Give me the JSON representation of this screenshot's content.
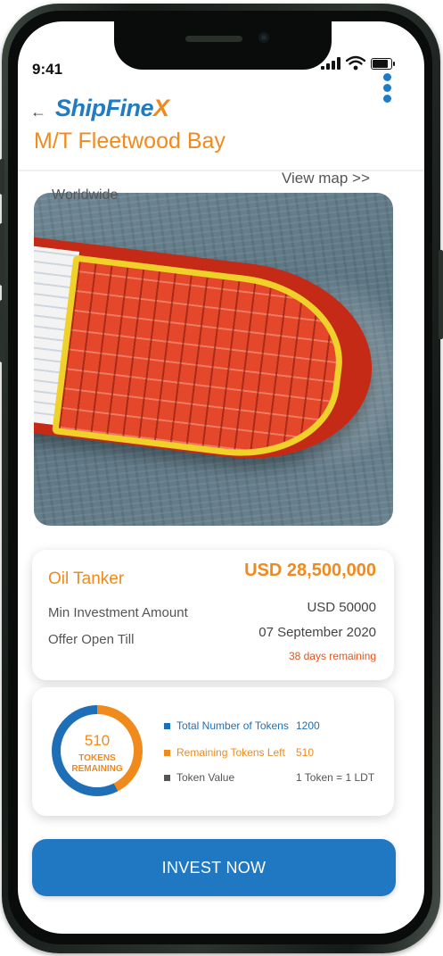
{
  "status_bar": {
    "time": "9:41"
  },
  "header": {
    "logo_main": "ShipFine",
    "logo_accent": "X",
    "title": "M/T Fleetwood Bay"
  },
  "location": {
    "region": "Worldwide",
    "view_map_label": "View map >>"
  },
  "details": {
    "vessel_type": "Oil Tanker",
    "price": "USD 28,500,000",
    "min_investment_label": "Min Investment Amount",
    "min_investment_value": "USD 50000",
    "offer_open_label": "Offer Open Till",
    "offer_open_value": "07 September 2020",
    "days_remaining": "38 days remaining"
  },
  "tokens": {
    "remaining_count": "510",
    "remaining_caption_line1": "TOKENS",
    "remaining_caption_line2": "REMAINING",
    "remaining_fraction": 0.425,
    "legend": [
      {
        "label": "Total Number of Tokens",
        "value": "1200",
        "color": "#1f6fb8"
      },
      {
        "label": "Remaining Tokens Left",
        "value": "510",
        "color": "#f08a1c"
      },
      {
        "label": "Token Value",
        "value": "1 Token = 1 LDT",
        "color": "#555555"
      }
    ]
  },
  "cta": {
    "invest_label": "INVEST NOW"
  },
  "colors": {
    "brand_blue": "#1f7cc4",
    "accent_orange": "#f08a1c"
  }
}
